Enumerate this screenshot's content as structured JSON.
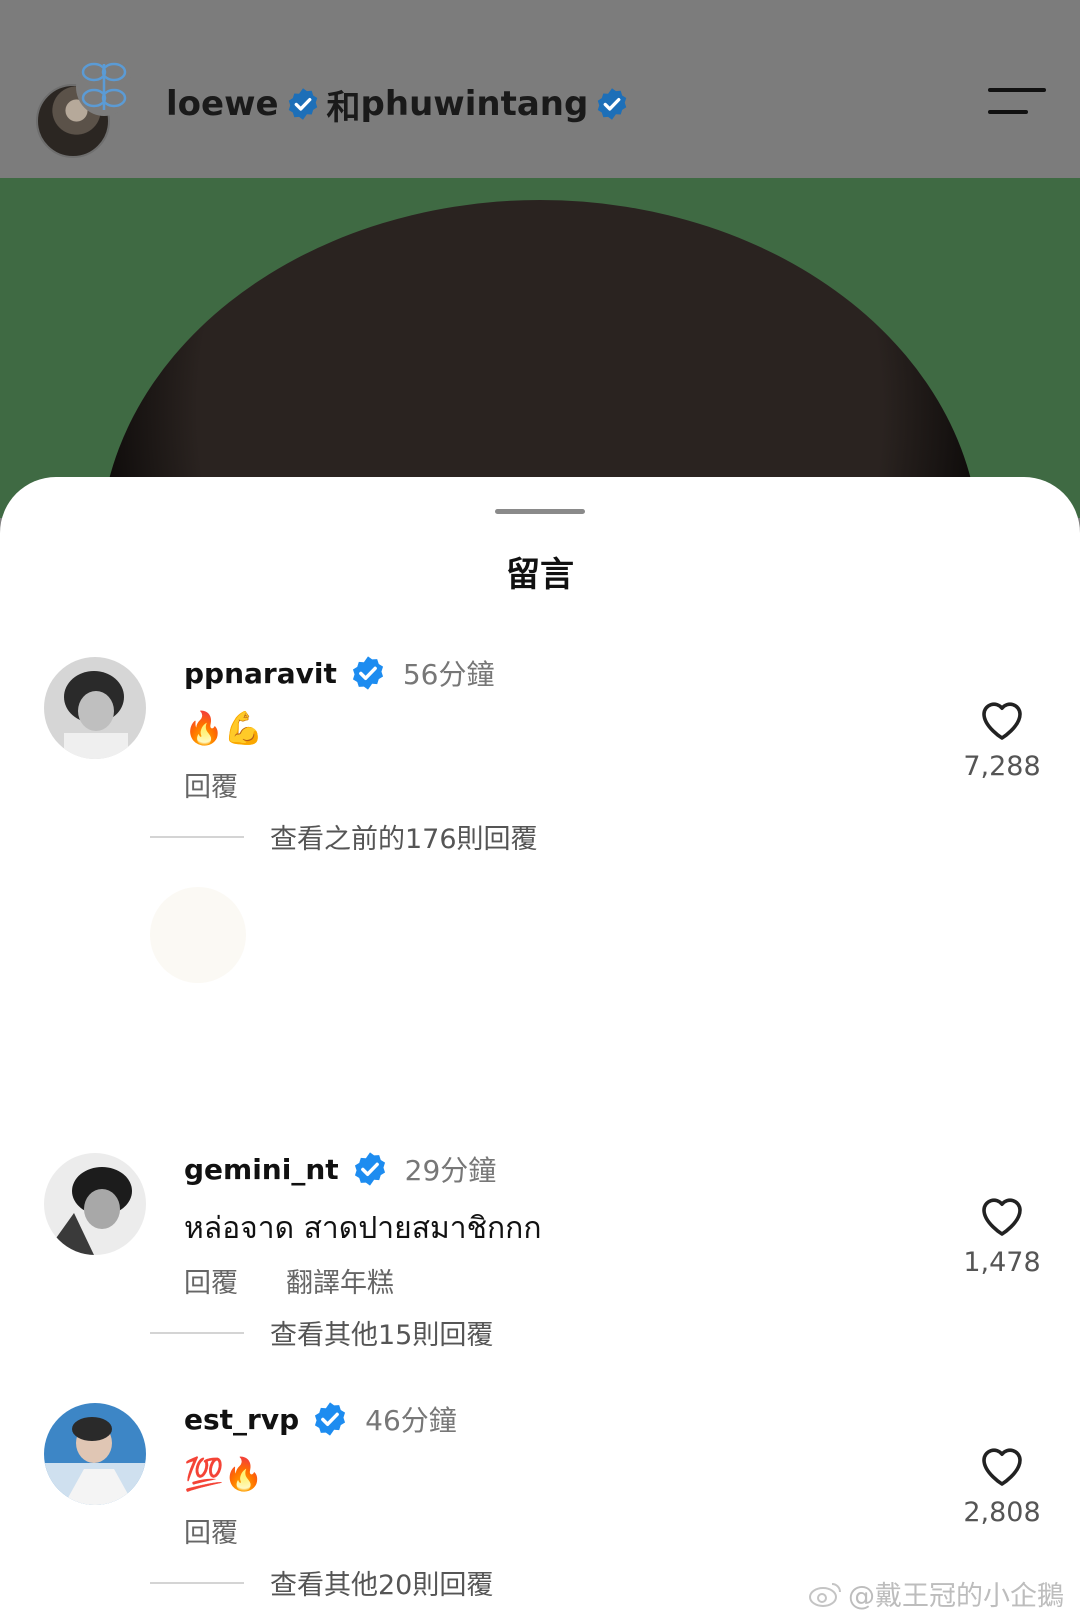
{
  "header": {
    "account1": "loewe",
    "joiner": "和",
    "account2": "phuwintang"
  },
  "sheet": {
    "title": "留言"
  },
  "comments": [
    {
      "username": "ppnaravit",
      "time": "56分鐘",
      "text": "🔥💪",
      "reply_label": "回覆",
      "likes": "7,288",
      "view_replies": "查看之前的176則回覆"
    },
    {
      "username": "gemini_nt",
      "time": "29分鐘",
      "text": "หล่อจาด สาดปายสมาชิกกก",
      "reply_label": "回覆",
      "translate_label": "翻譯年糕",
      "likes": "1,478",
      "view_replies": "查看其他15則回覆"
    },
    {
      "username": "est_rvp",
      "time": "46分鐘",
      "text": "💯🔥",
      "reply_label": "回覆",
      "likes": "2,808",
      "view_replies": "查看其他20則回覆"
    }
  ],
  "watermark": "@戴王冠的小企鵝",
  "colors": {
    "verified": "#1d8cf0",
    "photo_bg": "#3f6a43",
    "header_bg": "#7c7c7c"
  }
}
